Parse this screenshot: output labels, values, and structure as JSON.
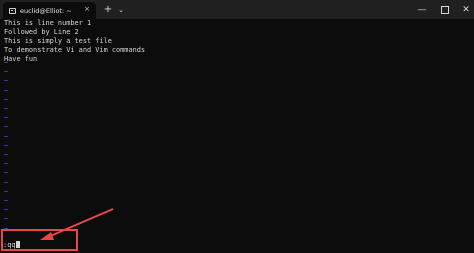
{
  "window": {
    "tab_title": "euclid@Elliot: ~",
    "tab_close_icon": "×",
    "new_tab_icon": "+",
    "dropdown_icon": "⌄",
    "minimize_icon": "—",
    "close_icon": "✕"
  },
  "editor": {
    "lines": [
      "This is line number 1",
      "Followed by Line 2",
      "This is simply a test file",
      "To demonstrate Vi and Vim commands",
      "Have fun"
    ],
    "tilde": "~",
    "command": ":qq"
  },
  "colors": {
    "background": "#0c0c0c",
    "text": "#d6d6d6",
    "tilde": "#4a63ff",
    "annotation": "#e8474a"
  }
}
